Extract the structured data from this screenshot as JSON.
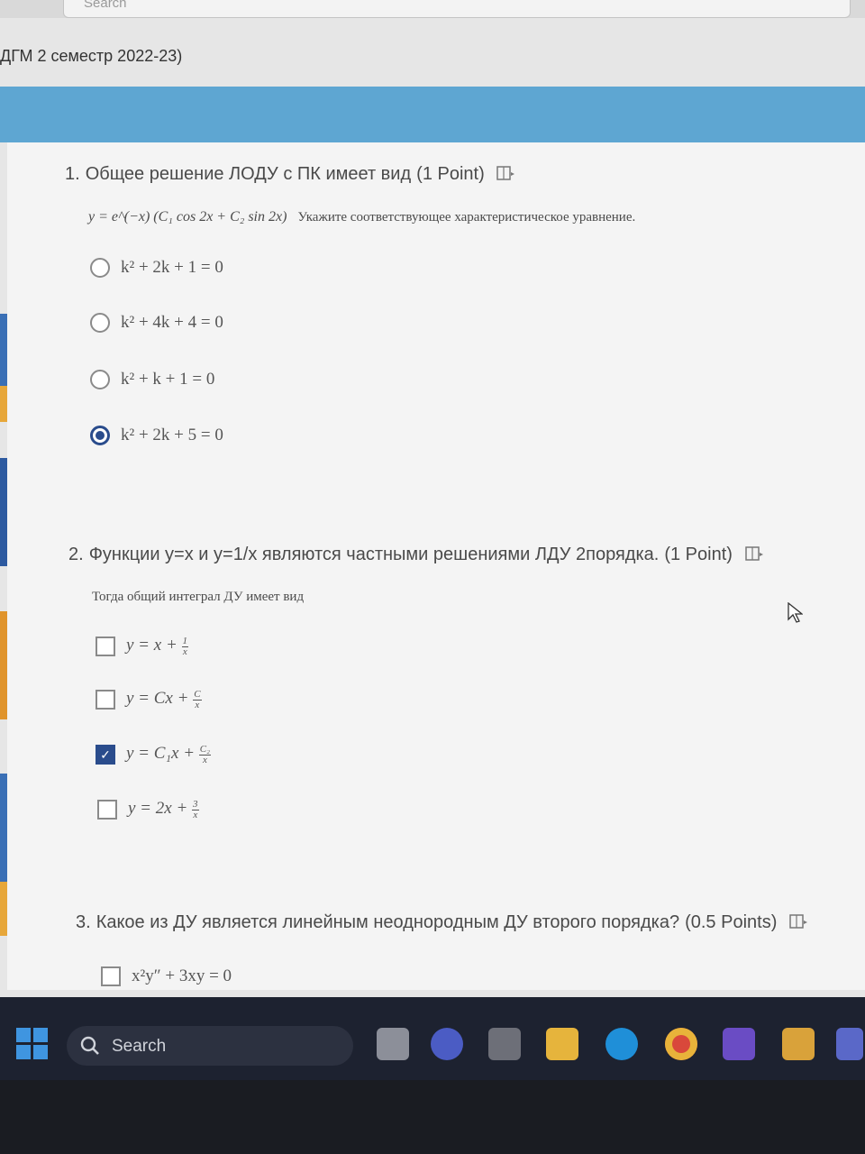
{
  "top_search": {
    "label": "Search"
  },
  "form": {
    "title": "ДГМ 2 семестр 2022-23)"
  },
  "questions": [
    {
      "number": "1.",
      "title": "Общее решение ЛОДУ с ПК имеет вид",
      "points": "(1 Point)",
      "formula": "y = e^(−x) (C₁ cos 2x + C₂ sin 2x)",
      "subtitle": "Укажите соответствующее  характеристическое уравнение.",
      "type": "radio",
      "options": [
        {
          "label": "k² + 2k + 1 = 0",
          "selected": false
        },
        {
          "label": "k² + 4k + 4 = 0",
          "selected": false
        },
        {
          "label": "k² + k + 1 = 0",
          "selected": false
        },
        {
          "label": "k² + 2k + 5 = 0",
          "selected": true
        }
      ]
    },
    {
      "number": "2.",
      "title": "Функции y=x и y=1/x являются частными решениями ЛДУ 2порядка.",
      "points": "(1 Point)",
      "subtitle": "Тогда общий интеграл ДУ имеет вид",
      "type": "checkbox",
      "options": [
        {
          "prefix": "y = x + ",
          "num": "1",
          "den": "x",
          "selected": false
        },
        {
          "prefix": "y = Cx + ",
          "num": "C",
          "den": "x",
          "selected": false
        },
        {
          "prefix": "y = C₁x + ",
          "num": "C₂",
          "den": "x",
          "selected": true
        },
        {
          "prefix": "y = 2x + ",
          "num": "3",
          "den": "x",
          "selected": false
        }
      ]
    },
    {
      "number": "3.",
      "title": "Какое из ДУ является линейным неоднородным ДУ второго порядка?",
      "points": "(0.5 Points)",
      "type": "checkbox",
      "options": [
        {
          "label": "x²y″ + 3xy = 0",
          "selected": false
        }
      ]
    }
  ],
  "taskbar": {
    "search_label": "Search",
    "apps": [
      "task-view",
      "teams-meet",
      "microsoft-store",
      "file-explorer",
      "edge",
      "chrome",
      "visual-studio",
      "app-yellow",
      "teams"
    ]
  },
  "colors": {
    "banner": "#5ea6d2",
    "selected": "#2a4c8c",
    "taskbar": "#1d2230"
  }
}
